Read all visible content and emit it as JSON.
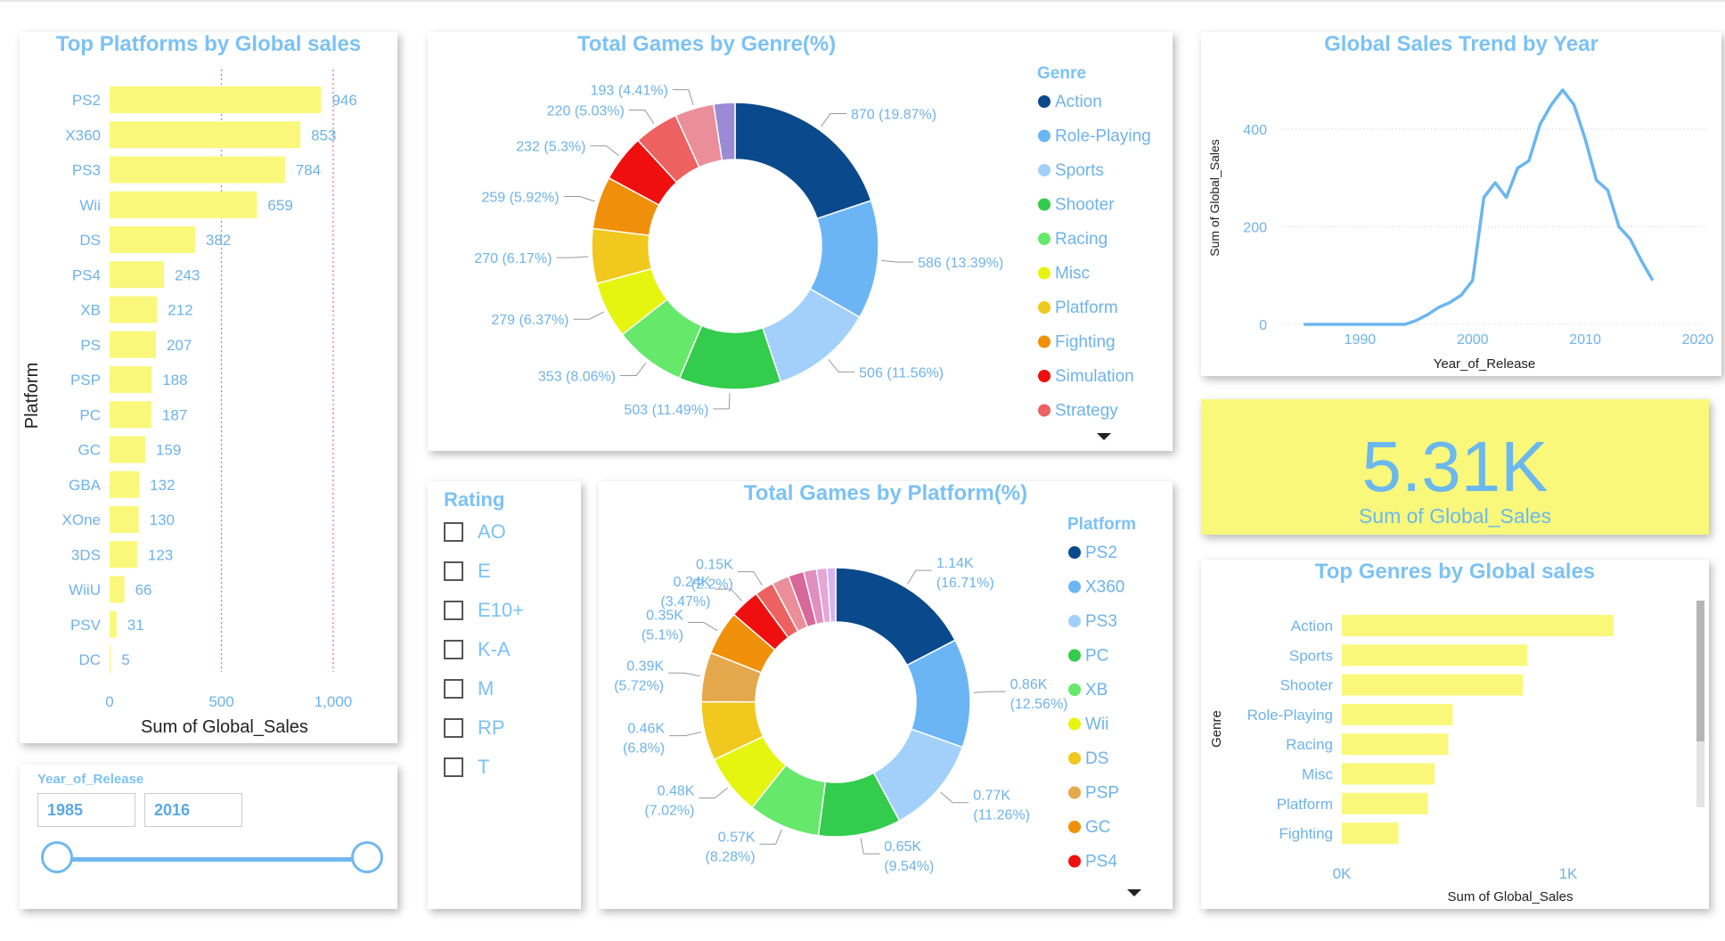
{
  "colors": {
    "accent": "#7cc2f5",
    "bar": "#f9f87b",
    "line": "#6bb6f0",
    "grid_ref": "#e66b7a",
    "genre": [
      "#0a4a8c",
      "#6cb5f5",
      "#a3d0fb",
      "#33cc4d",
      "#66e86b",
      "#e6f50f",
      "#f0c81e",
      "#f0900a",
      "#f00f0f",
      "#ee6161",
      "#ea8f9a",
      "#9b8bd4"
    ],
    "platform": [
      "#0a4a8c",
      "#6cb5f5",
      "#a3d0fb",
      "#33cc4d",
      "#66e86b",
      "#e6f50f",
      "#f0c81e",
      "#e6a84c",
      "#f0900a",
      "#f00f0f",
      "#ee6161",
      "#ea8f9a",
      "#d8679a",
      "#e08fc0",
      "#e6a6d8",
      "#d8b4f0"
    ]
  },
  "dropdown_icon": "triangle-down-icon",
  "kpi": {
    "value": "5.31K",
    "label": "Sum of Global_Sales"
  },
  "year_slicer": {
    "title": "Year_of_Release",
    "start": "1985",
    "end": "2016",
    "range": [
      1985,
      2016
    ]
  },
  "rating_slicer": {
    "title": "Rating",
    "items": [
      "AO",
      "E",
      "E10+",
      "K-A",
      "M",
      "RP",
      "T"
    ]
  },
  "chart_data": [
    {
      "id": "platforms",
      "type": "bar",
      "orientation": "horizontal",
      "title": "Top Platforms by Global sales",
      "xlabel": "Sum of Global_Sales",
      "ylabel": "Platform",
      "categories": [
        "PS2",
        "X360",
        "PS3",
        "Wii",
        "DS",
        "PS4",
        "XB",
        "PS",
        "PSP",
        "PC",
        "GC",
        "GBA",
        "XOne",
        "3DS",
        "WiiU",
        "PSV",
        "DC"
      ],
      "values": [
        946,
        853,
        784,
        659,
        382,
        243,
        212,
        207,
        188,
        187,
        159,
        132,
        130,
        123,
        66,
        31,
        5
      ],
      "xticks": [
        0,
        500,
        1000
      ],
      "xtick_labels": [
        "0",
        "500",
        "1,000"
      ],
      "xlim": [
        0,
        1000
      ],
      "reference_lines": [
        500,
        1000
      ]
    },
    {
      "id": "genre_pct",
      "type": "pie",
      "style": "donut",
      "title": "Total Games by Genre(%)",
      "legend_title": "Genre",
      "legend_placement": "right",
      "legend": [
        "Action",
        "Role-Playing",
        "Sports",
        "Shooter",
        "Racing",
        "Misc",
        "Platform",
        "Fighting",
        "Simulation",
        "Strategy"
      ],
      "values": [
        870,
        586,
        506,
        503,
        353,
        279,
        270,
        259,
        232,
        220,
        193,
        105
      ],
      "labels": [
        "870 (19.87%)",
        "586 (13.39%)",
        "506 (11.56%)",
        "503 (11.49%)",
        "353 (8.06%)",
        "279 (6.37%)",
        "270 (6.17%)",
        "259 (5.92%)",
        "232 (5.3%)",
        "220 (5.03%)",
        "193 (4.41%)",
        ""
      ]
    },
    {
      "id": "trend",
      "type": "line",
      "title": "Global Sales Trend by Year",
      "xlabel": "Year_of_Release",
      "ylabel": "Sum of Global_Sales",
      "x": [
        1985,
        1986,
        1987,
        1988,
        1989,
        1990,
        1991,
        1992,
        1993,
        1994,
        1995,
        1996,
        1997,
        1998,
        1999,
        2000,
        2001,
        2002,
        2003,
        2004,
        2005,
        2006,
        2007,
        2008,
        2009,
        2010,
        2011,
        2012,
        2013,
        2014,
        2015,
        2016
      ],
      "y": [
        0,
        0,
        0,
        0,
        0,
        0,
        0,
        0,
        0,
        0,
        8,
        20,
        35,
        45,
        60,
        90,
        260,
        290,
        260,
        320,
        335,
        410,
        450,
        480,
        450,
        380,
        295,
        275,
        200,
        175,
        130,
        90
      ],
      "xticks": [
        1990,
        2000,
        2010,
        2020
      ],
      "yticks": [
        0,
        200,
        400
      ],
      "xlim": [
        1983,
        2021
      ],
      "ylim": [
        0,
        500
      ],
      "grid": true
    },
    {
      "id": "platform_pct",
      "type": "pie",
      "style": "donut",
      "title": "Total Games by Platform(%)",
      "legend_title": "Platform",
      "legend_placement": "right",
      "legend": [
        "PS2",
        "X360",
        "PS3",
        "PC",
        "XB",
        "Wii",
        "DS",
        "PSP",
        "GC",
        "PS4"
      ],
      "values": [
        16.71,
        12.56,
        11.26,
        9.54,
        8.28,
        7.02,
        6.8,
        5.72,
        5.1,
        3.47,
        2.2,
        2.0,
        1.8,
        1.5,
        1.2,
        1.0
      ],
      "labels": [
        "1.14K (16.71%)",
        "0.86K (12.56%)",
        "0.77K (11.26%)",
        "0.65K (9.54%)",
        "0.57K (8.28%)",
        "0.48K (7.02%)",
        "0.46K (6.8%)",
        "0.39K (5.72%)",
        "0.35K (5.1%)",
        "0.24K (3.47%)",
        "0.15K (2.2%)",
        "",
        "",
        "",
        "",
        ""
      ]
    },
    {
      "id": "genres_sales",
      "type": "bar",
      "orientation": "horizontal",
      "title": "Top Genres by Global sales",
      "xlabel": "Sum of Global_Sales",
      "ylabel": "Genre",
      "categories": [
        "Action",
        "Sports",
        "Shooter",
        "Role-Playing",
        "Racing",
        "Misc",
        "Platform",
        "Fighting"
      ],
      "values": [
        1200,
        820,
        800,
        490,
        470,
        410,
        380,
        250
      ],
      "xticks": [
        0,
        1000
      ],
      "xtick_labels": [
        "0K",
        "1K"
      ],
      "xlim": [
        0,
        1000
      ]
    }
  ]
}
